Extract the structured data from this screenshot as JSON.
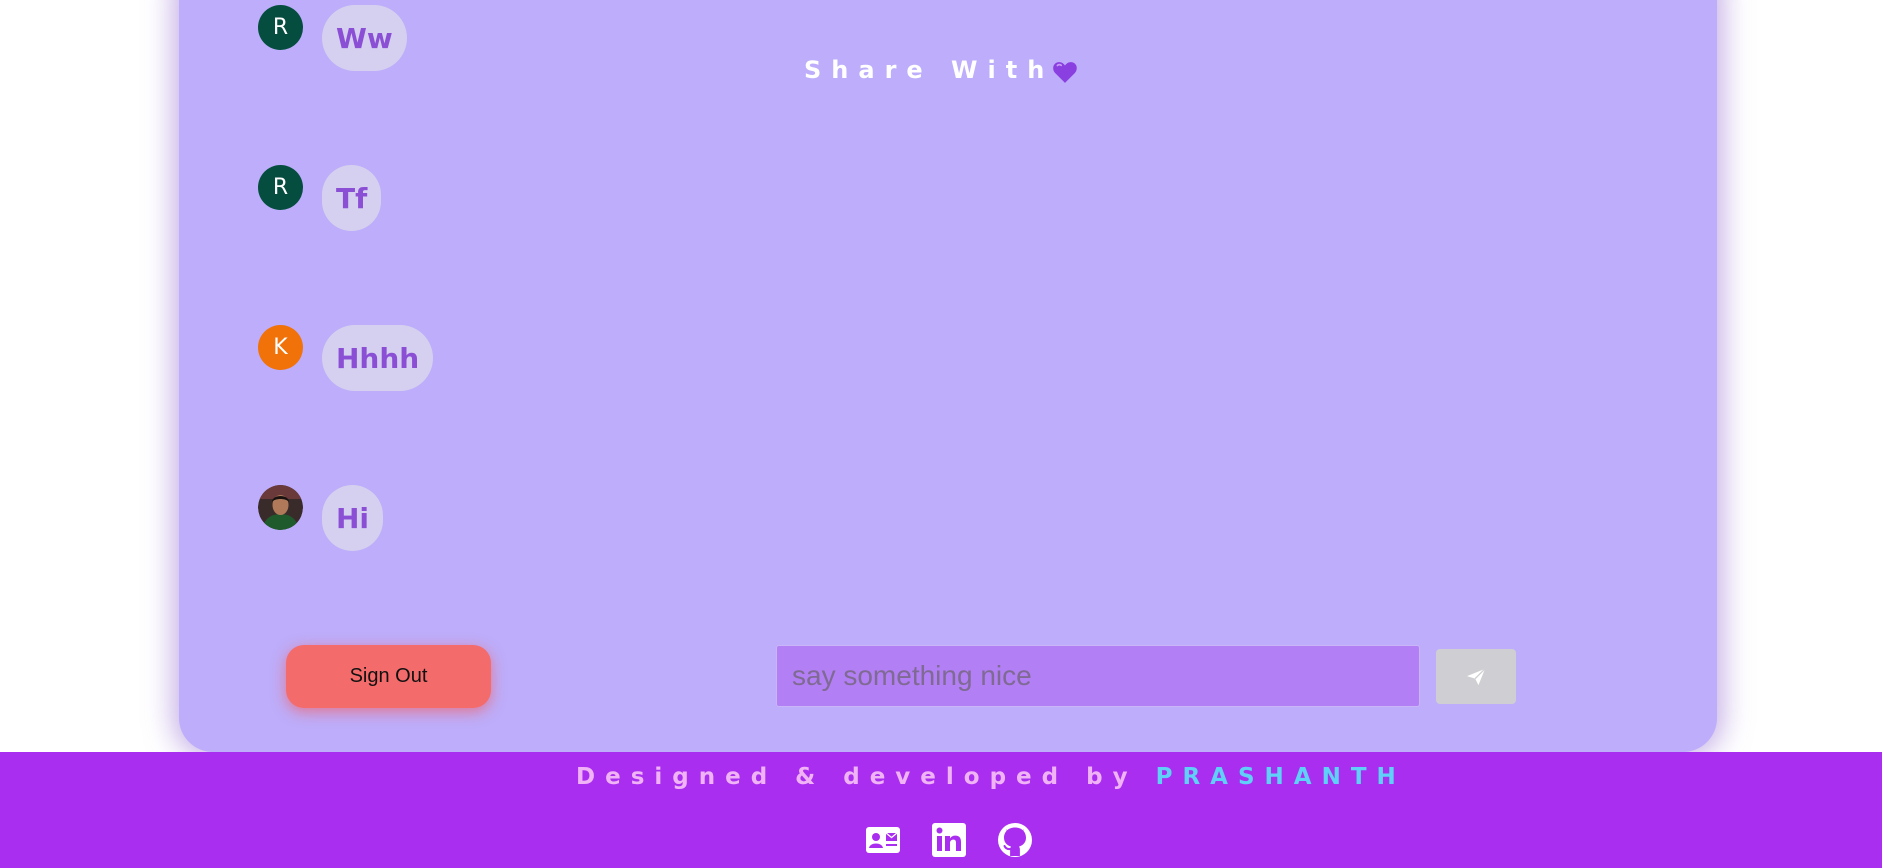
{
  "header": {
    "title": "Share With",
    "heart_icon": "purple-heart-icon"
  },
  "messages": [
    {
      "avatar_type": "initial",
      "initial": "R",
      "avatar_color": "#054d3f",
      "text": "Ww"
    },
    {
      "avatar_type": "initial",
      "initial": "R",
      "avatar_color": "#054d3f",
      "text": "Tf"
    },
    {
      "avatar_type": "initial",
      "initial": "K",
      "avatar_color": "#f07208",
      "text": "Hhhh"
    },
    {
      "avatar_type": "photo",
      "initial": "",
      "avatar_color": "#2e3b2e",
      "text": "Hi"
    }
  ],
  "composer": {
    "sign_out_label": "Sign Out",
    "input_placeholder": "say something nice",
    "input_value": "",
    "send_icon": "paper-plane-icon"
  },
  "footer": {
    "credit_prefix": "Designed & developed by",
    "credit_name": "PRASHANTH",
    "icons": [
      "contact-card-icon",
      "linkedin-icon",
      "github-icon"
    ]
  },
  "colors": {
    "card_background": "#bdadfa",
    "footer_background": "#a92ef0",
    "bubble_text": "#8b4fd6",
    "sign_out": "#f46b6b",
    "input_background": "#b37ff4",
    "author_name": "#5fd0f7"
  }
}
